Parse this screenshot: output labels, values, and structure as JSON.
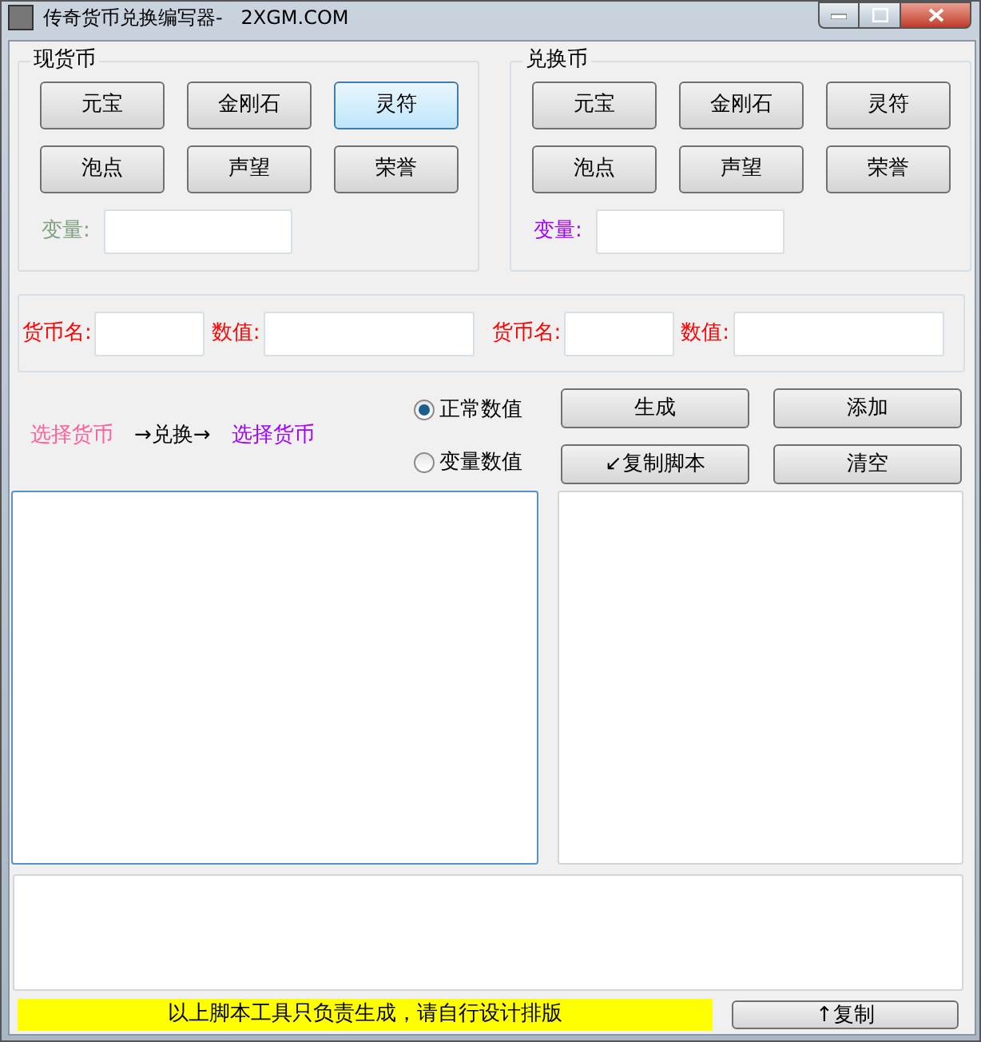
{
  "window": {
    "title": "传奇货币兑换编写器-   2XGM.COM"
  },
  "groups": [
    {
      "title": "现货币",
      "buttons": [
        {
          "label": "元宝",
          "highlighted": false
        },
        {
          "label": "金刚石",
          "highlighted": false
        },
        {
          "label": "灵符",
          "highlighted": true
        },
        {
          "label": "泡点",
          "highlighted": false
        },
        {
          "label": "声望",
          "highlighted": false
        },
        {
          "label": "荣誉",
          "highlighted": false
        }
      ],
      "variable_label": "变量:",
      "color": "#7f9f7f"
    },
    {
      "title": "兑换币",
      "buttons": [
        {
          "label": "元宝",
          "highlighted": false
        },
        {
          "label": "金刚石",
          "highlighted": false
        },
        {
          "label": "灵符",
          "highlighted": false
        },
        {
          "label": "泡点",
          "highlighted": false
        },
        {
          "label": "声望",
          "highlighted": false
        },
        {
          "label": "荣誉",
          "highlighted": false
        }
      ],
      "variable_label": "变量:",
      "color": "#a000ff"
    }
  ],
  "fields": [
    {
      "label": "货币名:",
      "kind": "short"
    },
    {
      "label": "数值:",
      "kind": "long"
    },
    {
      "label": "货币名:",
      "kind": "short"
    },
    {
      "label": "数值:",
      "kind": "long"
    }
  ],
  "exchange": [
    {
      "text": "选择货币",
      "color": "#ff5e9a"
    },
    {
      "text": "→兑换→",
      "color": "#000000"
    },
    {
      "text": "选择货币",
      "color": "#a000ff"
    }
  ],
  "radios": [
    {
      "label": "正常数值",
      "selected": true
    },
    {
      "label": "变量数值",
      "selected": false
    }
  ],
  "actions": [
    "生成",
    "添加",
    "↙复制脚本",
    "清空"
  ],
  "notice": "以上脚本工具只负责生成，请自行设计排版",
  "copy_button": "↑复制"
}
